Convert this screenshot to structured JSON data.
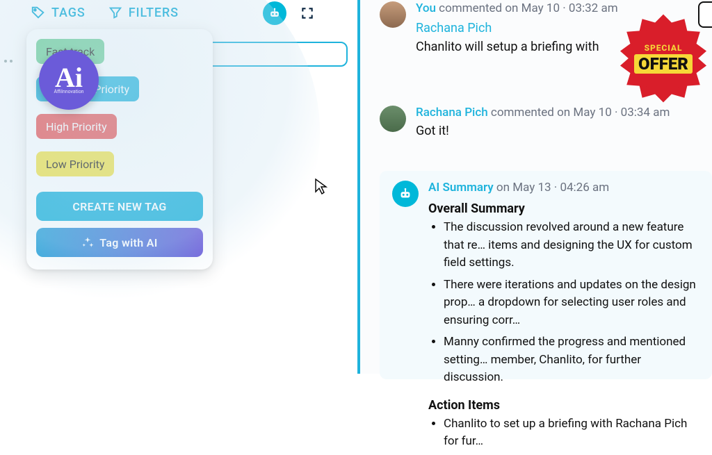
{
  "toolbar": {
    "tags_label": "TAGS",
    "filters_label": "FILTERS"
  },
  "input": {
    "placeholder": ""
  },
  "tags_dropdown": {
    "tags": [
      {
        "label": "Fast track",
        "color": "green"
      },
      {
        "label": "ack, High Priority",
        "full_label_guess": "Fast track, High Priority",
        "color": "blue"
      },
      {
        "label": "High Priority",
        "color": "red"
      },
      {
        "label": "Low Priority",
        "color": "yellow"
      }
    ],
    "create_label": "CREATE NEW TAG",
    "ai_label": "Tag with AI"
  },
  "overlay_badge": {
    "main": "Ai",
    "sub": "AffiInnovation"
  },
  "right_panel": {
    "comment_1": {
      "meta_prefix": "You",
      "meta_action": " commented on ",
      "meta_date": "May 10",
      "meta_time": "03:32 am",
      "mention": "Rachana Pich",
      "body": "Chanlito will setup a briefing with"
    },
    "comment_2": {
      "author": "Rachana Pich",
      "meta_action": " commented on ",
      "meta_date": "May 10",
      "meta_time": "03:34 am",
      "body": "Got it!"
    },
    "summary": {
      "author": "AI Summary",
      "meta_prefix": " on ",
      "meta_date": "May 13",
      "meta_time": "04:26 am",
      "heading_1": "Overall Summary",
      "bullets_1": [
        "The discussion revolved around a new feature that re… items and designing the UX for custom field settings.",
        "There were iterations and updates on the design prop… a dropdown for selecting user roles and ensuring corr…",
        "Manny confirmed the progress and mentioned setting… member, Chanlito, for further discussion."
      ],
      "heading_2": "Action Items",
      "bullets_2": [
        "Chanlito to set up a briefing with Rachana Pich for fur…"
      ]
    }
  },
  "promo": {
    "special": "SPECIAL",
    "offer": "OFFER"
  },
  "colors": {
    "brand_cyan": "#1EB3DC",
    "brand_purple": "#6B5BD9",
    "promo_red": "#D91E2A",
    "promo_yellow": "#F6D838"
  }
}
